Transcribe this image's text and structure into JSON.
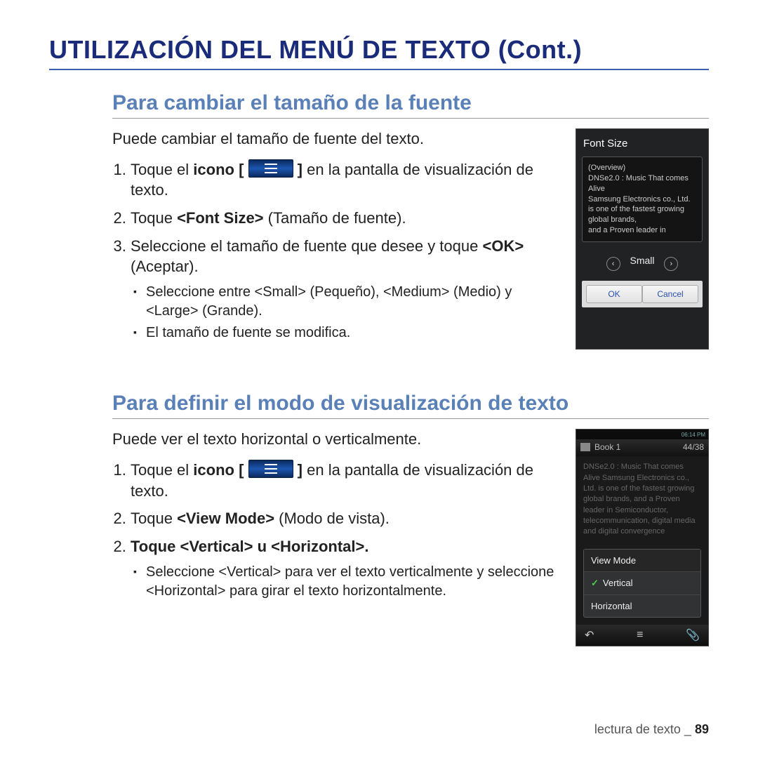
{
  "title": "UTILIZACIÓN DEL MENÚ DE TEXTO (Cont.)",
  "section1": {
    "heading": "Para cambiar el tamaño de la fuente",
    "intro": "Puede cambiar el tamaño de fuente del texto.",
    "step1_a": "Toque el ",
    "step1_b": "icono [",
    "step1_c": "] ",
    "step1_d": "en la pantalla de visualización de texto.",
    "step2_a": "Toque ",
    "step2_b": "<Font Size>",
    "step2_c": " (Tamaño de fuente).",
    "step3_a": "Seleccione el tamaño de fuente que desee y toque ",
    "step3_b": "<OK>",
    "step3_c": " (Aceptar).",
    "sub1": "Seleccione entre <Small> (Pequeño), <Medium> (Medio) y <Large> (Grande).",
    "sub2": "El tamaño de fuente se modifica."
  },
  "device1": {
    "title": "Font Size",
    "preview_l1": "(Overview)",
    "preview_l2": "DNSe2.0 : Music That comes Alive",
    "preview_l3": "Samsung Electronics co., Ltd. is one of the fastest growing global brands,",
    "preview_l4": "and a Proven leader in",
    "selection": "Small",
    "ok": "OK",
    "cancel": "Cancel"
  },
  "section2": {
    "heading": "Para definir el modo de visualización de texto",
    "intro": "Puede ver el texto horizontal o verticalmente.",
    "step1_a": "Toque el ",
    "step1_b": "icono [",
    "step1_c": "] ",
    "step1_d": "en la pantalla de visualización de texto.",
    "step2_a": "Toque ",
    "step2_b": "<View Mode>",
    "step2_c": " (Modo de vista).",
    "step3_a": "Toque ",
    "step3_b": "<Vertical>",
    "step3_c": " u ",
    "step3_d": "<Horizontal>",
    "step3_e": ".",
    "sub1": "Seleccione <Vertical> para ver el texto verticalmente y seleccione <Horizontal> para girar el texto horizontalmente."
  },
  "device2": {
    "status_left": "",
    "status_right": "06:14 PM",
    "book": "Book 1",
    "progress": "44/38",
    "body": "DNSe2.0 : Music That comes Alive\nSamsung Electronics co., Ltd. is one of the fastest growing global brands,\nand a Proven leader in Semiconductor, telecommunication, digital media and digital convergence",
    "menu_header": "View Mode",
    "opt_vertical": "Vertical",
    "opt_horizontal": "Horizontal"
  },
  "footer": {
    "section": "lectura de texto _",
    "page": "89"
  }
}
